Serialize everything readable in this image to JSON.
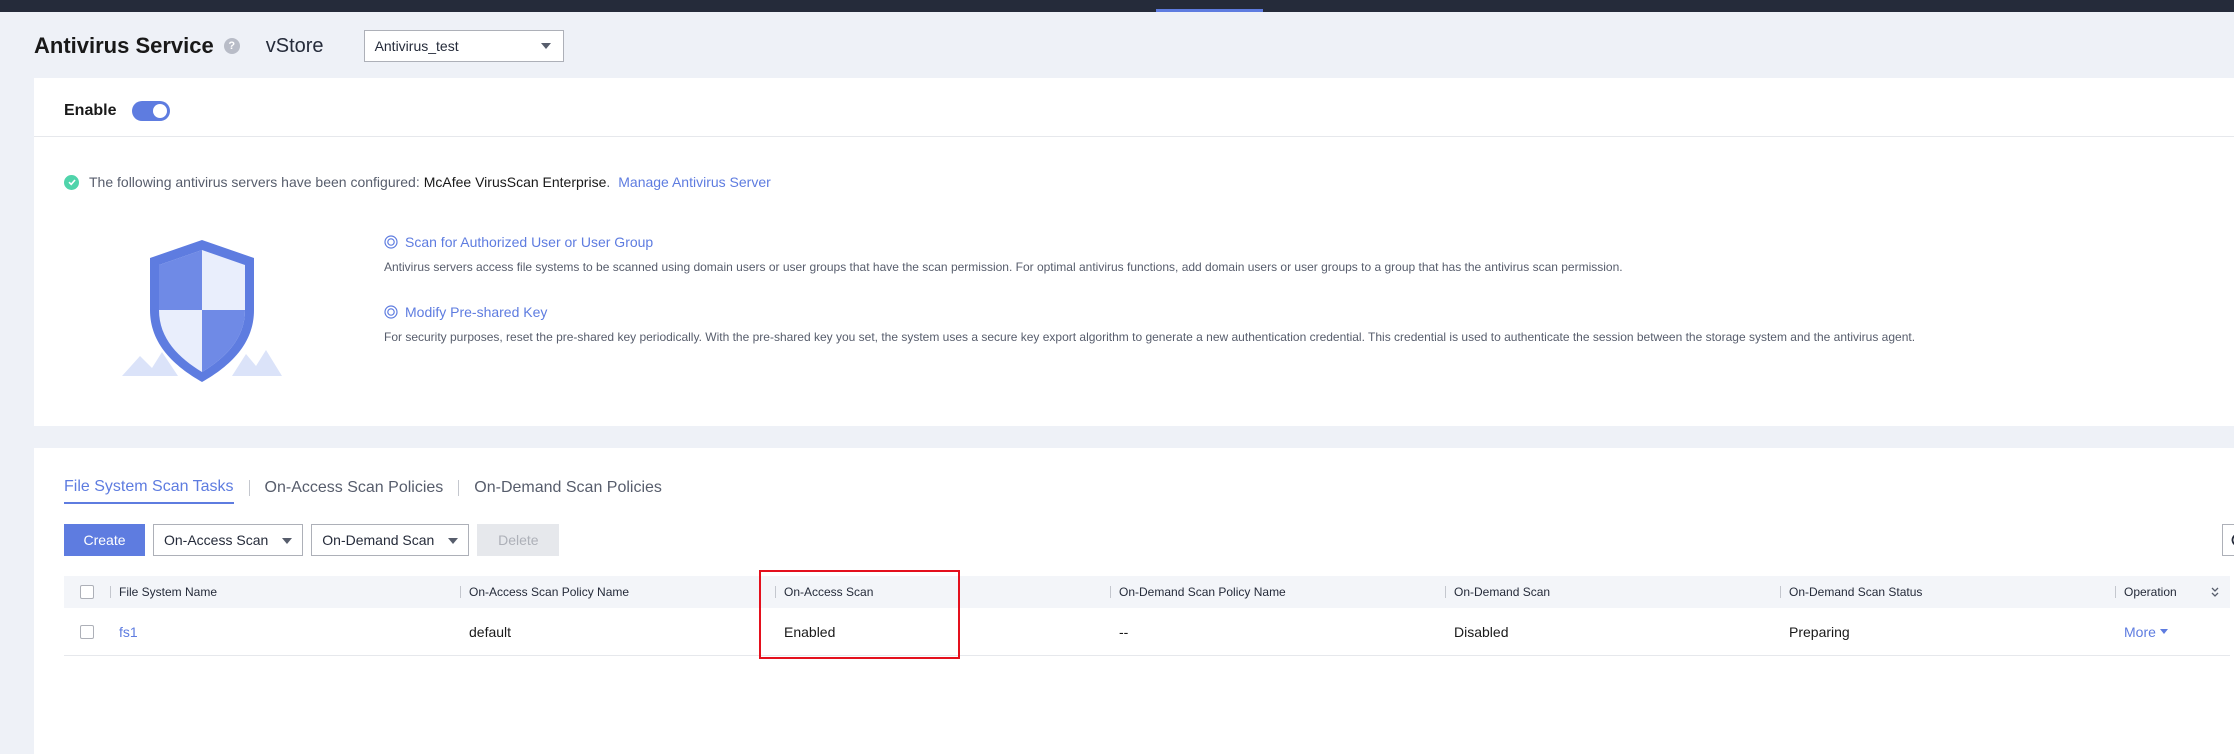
{
  "header": {
    "title": "Antivirus Service",
    "help_icon": "?",
    "vstore_label": "vStore",
    "vstore_selected": "Antivirus_test"
  },
  "enable": {
    "label": "Enable",
    "state": true
  },
  "notice": {
    "text": "The following antivirus servers have been configured:",
    "server": "McAfee VirusScan Enterprise",
    "dot": ".",
    "link": "Manage Antivirus Server"
  },
  "info": [
    {
      "title": "Scan for Authorized User or User Group",
      "desc": "Antivirus servers access file systems to be scanned using domain users or user groups that have the scan permission. For optimal antivirus functions, add domain users or user groups to a group that has the antivirus scan permission."
    },
    {
      "title": "Modify Pre-shared Key",
      "desc": "For security purposes, reset the pre-shared key periodically. With the pre-shared key you set, the system uses a secure key export algorithm to generate a new authentication credential. This credential is used to authenticate the session between the storage system and the antivirus agent."
    }
  ],
  "tabs": [
    "File System Scan Tasks",
    "On-Access Scan Policies",
    "On-Demand Scan Policies"
  ],
  "toolbar": {
    "create": "Create",
    "on_access": "On-Access Scan",
    "on_demand": "On-Demand Scan",
    "delete": "Delete"
  },
  "table": {
    "columns": [
      "File System Name",
      "On-Access Scan Policy Name",
      "On-Access Scan",
      "On-Demand Scan Policy Name",
      "On-Demand Scan",
      "On-Demand Scan Status",
      "Operation"
    ],
    "rows": [
      [
        "fs1",
        "default",
        "Enabled",
        "--",
        "Disabled",
        "Preparing",
        "More"
      ]
    ]
  },
  "colors": {
    "accent": "#5e7ce0",
    "success": "#50d4ab",
    "highlight": "#e4101d"
  }
}
